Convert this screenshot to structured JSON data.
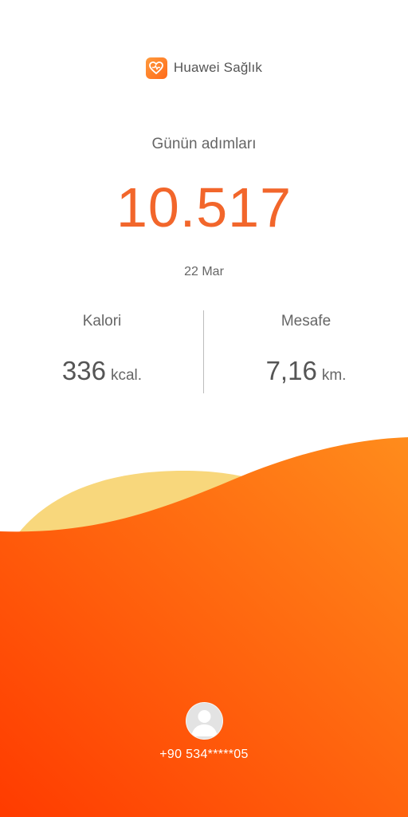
{
  "app": {
    "name": "Huawei Sağlık",
    "logo_icon": "heart-icon"
  },
  "steps": {
    "label": "Günün adımları",
    "value": "10.517",
    "date": "22 Mar"
  },
  "stats": {
    "calories": {
      "label": "Kalori",
      "value": "336",
      "unit": "kcal."
    },
    "distance": {
      "label": "Mesafe",
      "value": "7,16",
      "unit": "km."
    }
  },
  "profile": {
    "avatar_icon": "user-avatar-icon",
    "phone": "+90 534*****05"
  },
  "colors": {
    "accent": "#f2662b",
    "wave_start": "#ff3d00",
    "wave_end": "#ff8a1a",
    "sun": "#f7d97a"
  }
}
